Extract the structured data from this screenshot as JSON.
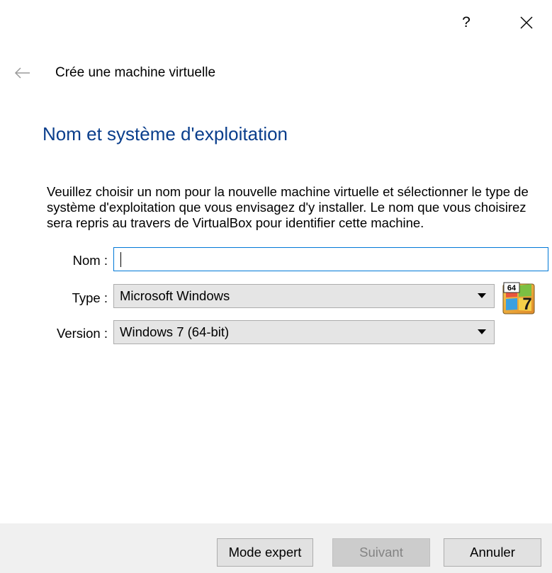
{
  "titlebar": {
    "help_label": "?",
    "close_icon": "close-icon"
  },
  "header": {
    "back_icon": "back-arrow-icon",
    "wizard_title": "Crée une machine virtuelle"
  },
  "page": {
    "heading": "Nom et système d'exploitation",
    "description": "Veuillez choisir un nom pour la nouvelle machine virtuelle et sélectionner le type de système d'exploitation que vous envisagez d'y installer. Le nom que vous choisirez sera repris au travers de VirtualBox pour identifier cette machine."
  },
  "form": {
    "name_label": "Nom :",
    "name_value": "",
    "type_label": "Type :",
    "type_value": "Microsoft Windows",
    "version_label": "Version :",
    "version_value": "Windows 7 (64-bit)",
    "os_icon": "windows-7-64-icon",
    "os_icon_badge": "64",
    "os_icon_number": "7"
  },
  "buttons": {
    "expert": "Mode expert",
    "next": "Suivant",
    "cancel": "Annuler"
  },
  "colors": {
    "heading": "#0a3e8c",
    "focus_border": "#0078d7",
    "bottom_bar": "#f0f0f0"
  }
}
